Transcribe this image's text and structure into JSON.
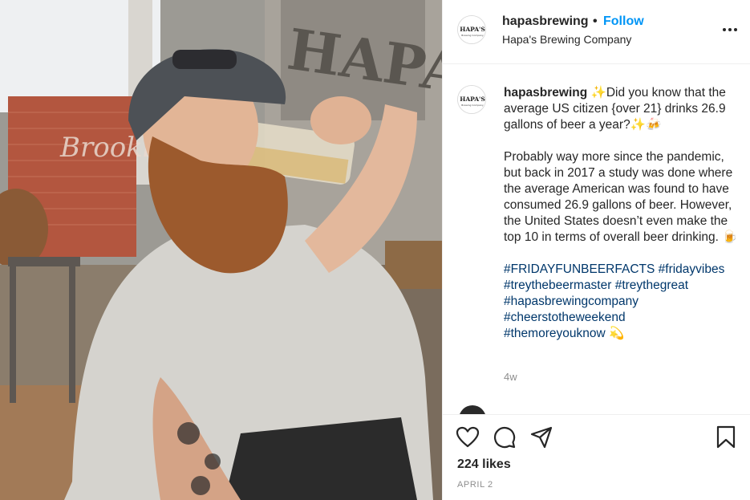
{
  "post": {
    "image_alt": "Bearded man in a cap drinking beer at a brewery",
    "sign_text": "HAPA'S",
    "brick_sign_text": "Brookl",
    "header": {
      "username": "hapasbrewing",
      "separator": "•",
      "follow_label": "Follow",
      "location": "Hapa's Brewing Company",
      "avatar_logo_text": "HAPA'S",
      "avatar_logo_sub": "Brewing Company"
    },
    "caption": {
      "username": "hapasbrewing",
      "para1": " ✨Did you know that the average US citizen {over 21} drinks 26.9 gallons of beer a year?✨🍻",
      "para2": "Probably way more since the pandemic, but back in 2017 a study was done where the average American was found to have consumed 26.9 gallons of beer. However, the United States doesn’t even make the top 10 in terms of overall beer drinking. 🍺",
      "hashtags": [
        "#FRIDAYFUNBEERFACTS",
        "#fridayvibes",
        "#treythebeermaster",
        "#treythegreat",
        "#hapasbrewingcompany",
        "#cheerstotheweekend",
        "#themoreyouknow"
      ],
      "tail_emoji": "💫",
      "age": "4w"
    },
    "likes": "224 likes",
    "date": "APRIL 2",
    "icons": [
      "heart-icon",
      "comment-icon",
      "share-icon",
      "bookmark-icon",
      "more-icon"
    ]
  }
}
